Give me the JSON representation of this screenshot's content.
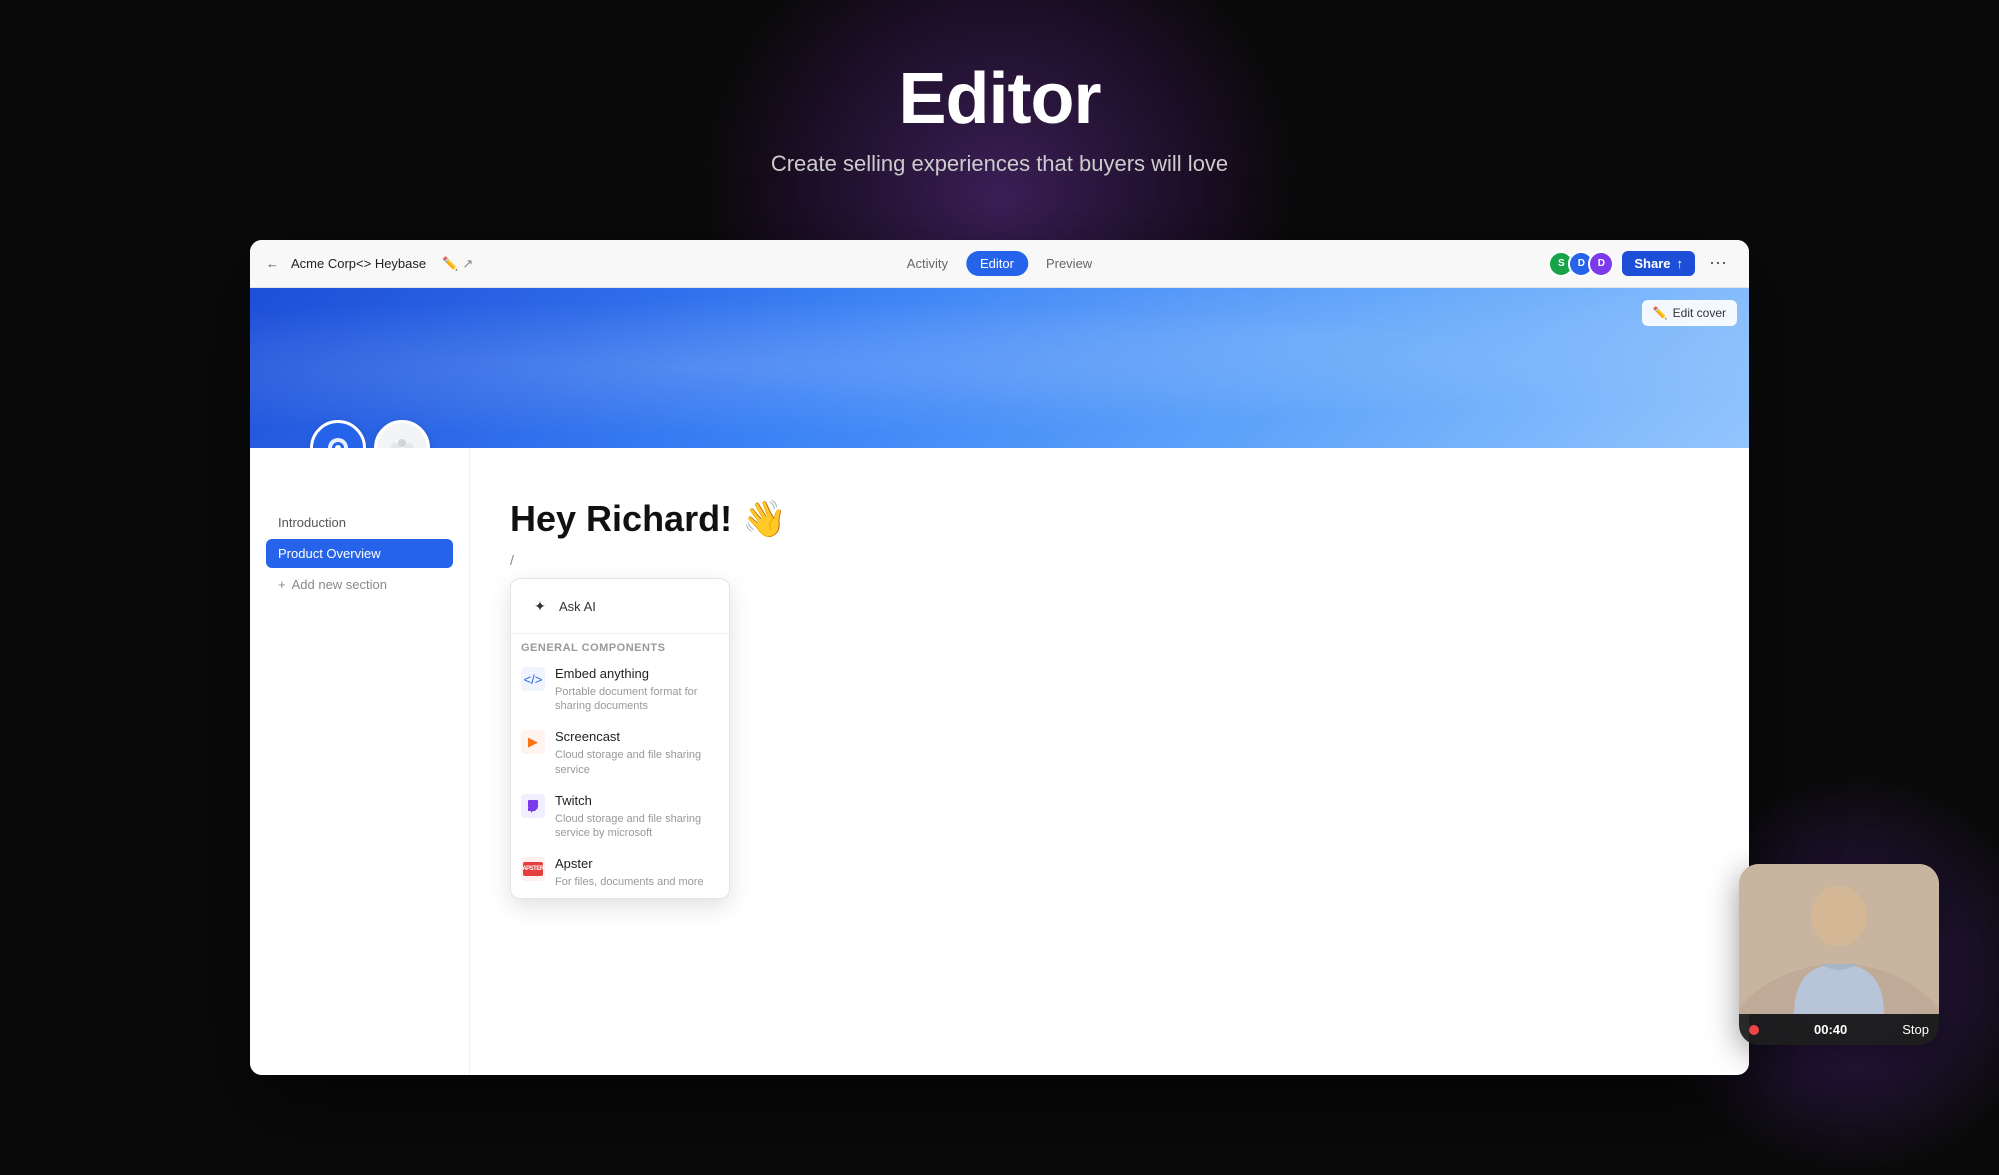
{
  "background": {
    "color": "#0a0a0a"
  },
  "hero": {
    "title": "Editor",
    "subtitle": "Create selling experiences that buyers will love"
  },
  "browser": {
    "breadcrumb": "Acme Corp<> Heybase",
    "nav_tabs": [
      {
        "label": "Activity",
        "active": false
      },
      {
        "label": "Editor",
        "active": true
      },
      {
        "label": "Preview",
        "active": false
      }
    ],
    "avatars": [
      {
        "label": "S",
        "color": "#16a34a"
      },
      {
        "label": "D",
        "color": "#2563eb"
      },
      {
        "label": "D",
        "color": "#7c3aed"
      }
    ],
    "share_button": "Share",
    "edit_cover_button": "Edit cover"
  },
  "sidebar": {
    "items": [
      {
        "label": "Introduction",
        "active": false
      },
      {
        "label": "Product Overview",
        "active": true
      }
    ],
    "add_section": "Add new section"
  },
  "editor": {
    "greeting": "Hey Richard! 👋",
    "slash_placeholder": "/"
  },
  "dropdown": {
    "ask_ai_label": "Ask AI",
    "section_label": "General components",
    "items": [
      {
        "title": "Embed anything",
        "description": "Portable document format for sharing documents",
        "icon_type": "embed"
      },
      {
        "title": "Screencast",
        "description": "Cloud storage and file sharing service",
        "icon_type": "screencast"
      },
      {
        "title": "Twitch",
        "description": "Cloud storage and file sharing service by microsoft",
        "icon_type": "twitch"
      },
      {
        "title": "Apster",
        "description": "For files, documents and more",
        "icon_type": "apster"
      }
    ]
  },
  "recording": {
    "time": "00:40",
    "stop_label": "Stop"
  }
}
